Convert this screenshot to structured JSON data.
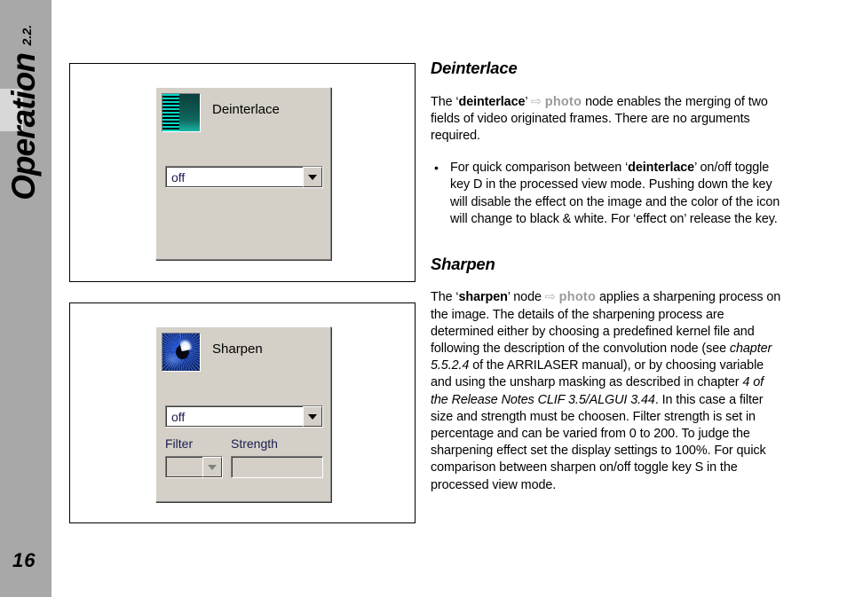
{
  "sidebar": {
    "chapter_number": "2.2.",
    "section_title": "Operation",
    "page_number": "16"
  },
  "figures": {
    "deinterlace": {
      "icon_name": "deinterlace-node-icon",
      "node_label": "Deinterlace",
      "mode_value": "off",
      "dropdown_arrow": "▼"
    },
    "sharpen": {
      "icon_name": "sharpen-node-icon",
      "node_label": "Sharpen",
      "mode_value": "off",
      "dropdown_arrow": "▼",
      "filter_label": "Filter",
      "strength_label": "Strength",
      "filter_value": "",
      "strength_value": ""
    }
  },
  "content": {
    "deinterlace": {
      "heading": "Deinterlace",
      "para_1": "The ‘",
      "para_1_bold": "deinterlace",
      "para_1_b": "’ ",
      "arrow": "⇨",
      "photo_tag": "photo",
      "para_1_c": " node enables the merging of two fields of video originated frames. There are no arguments required.",
      "bullet_1_a": "For quick comparison between ‘",
      "bullet_1_bold": "deinterlace",
      "bullet_1_b": "’ on/off toggle key D in the processed view mode. Pushing down the key will disable the effect on the image and the color of the icon will change to black & white. For ‘effect on’ release the key."
    },
    "sharpen": {
      "heading": "Sharpen",
      "para_a": "The ‘",
      "para_bold_1": "sharpen",
      "para_b": "’ node ",
      "arrow": "⇨",
      "photo_tag": "photo",
      "para_c": " applies a sharpening process on the image. The details of the sharpening process are determined either by choosing a predefined kernel file and following the description of the convolution node (see ",
      "para_italic_1": "chapter 5.5.2.4",
      "para_d": " of the ARRILASER manual), or by choosing variable and using the unsharp masking as described in chapter ",
      "para_italic_2": "4 of the Release Notes CLIF 3.5/ALGUI 3.44",
      "para_e": ". In this case a filter size and strength must be choosen. Filter strength is set in percentage and can be varied from 0 to 200. To judge the sharpening effect set the display settings to 100%. For quick comparison between sharpen on/off toggle key S in the processed view mode."
    }
  },
  "colors": {
    "sidebar_bg": "#a8a8a8",
    "sidebar_tab": "#d8d8d8",
    "panel_bg": "#d4d0c8",
    "photo_tag": "#9a9a9a",
    "deinterlace_teal": "#00d9c8",
    "sharpen_blue": "#1b4fd8"
  }
}
